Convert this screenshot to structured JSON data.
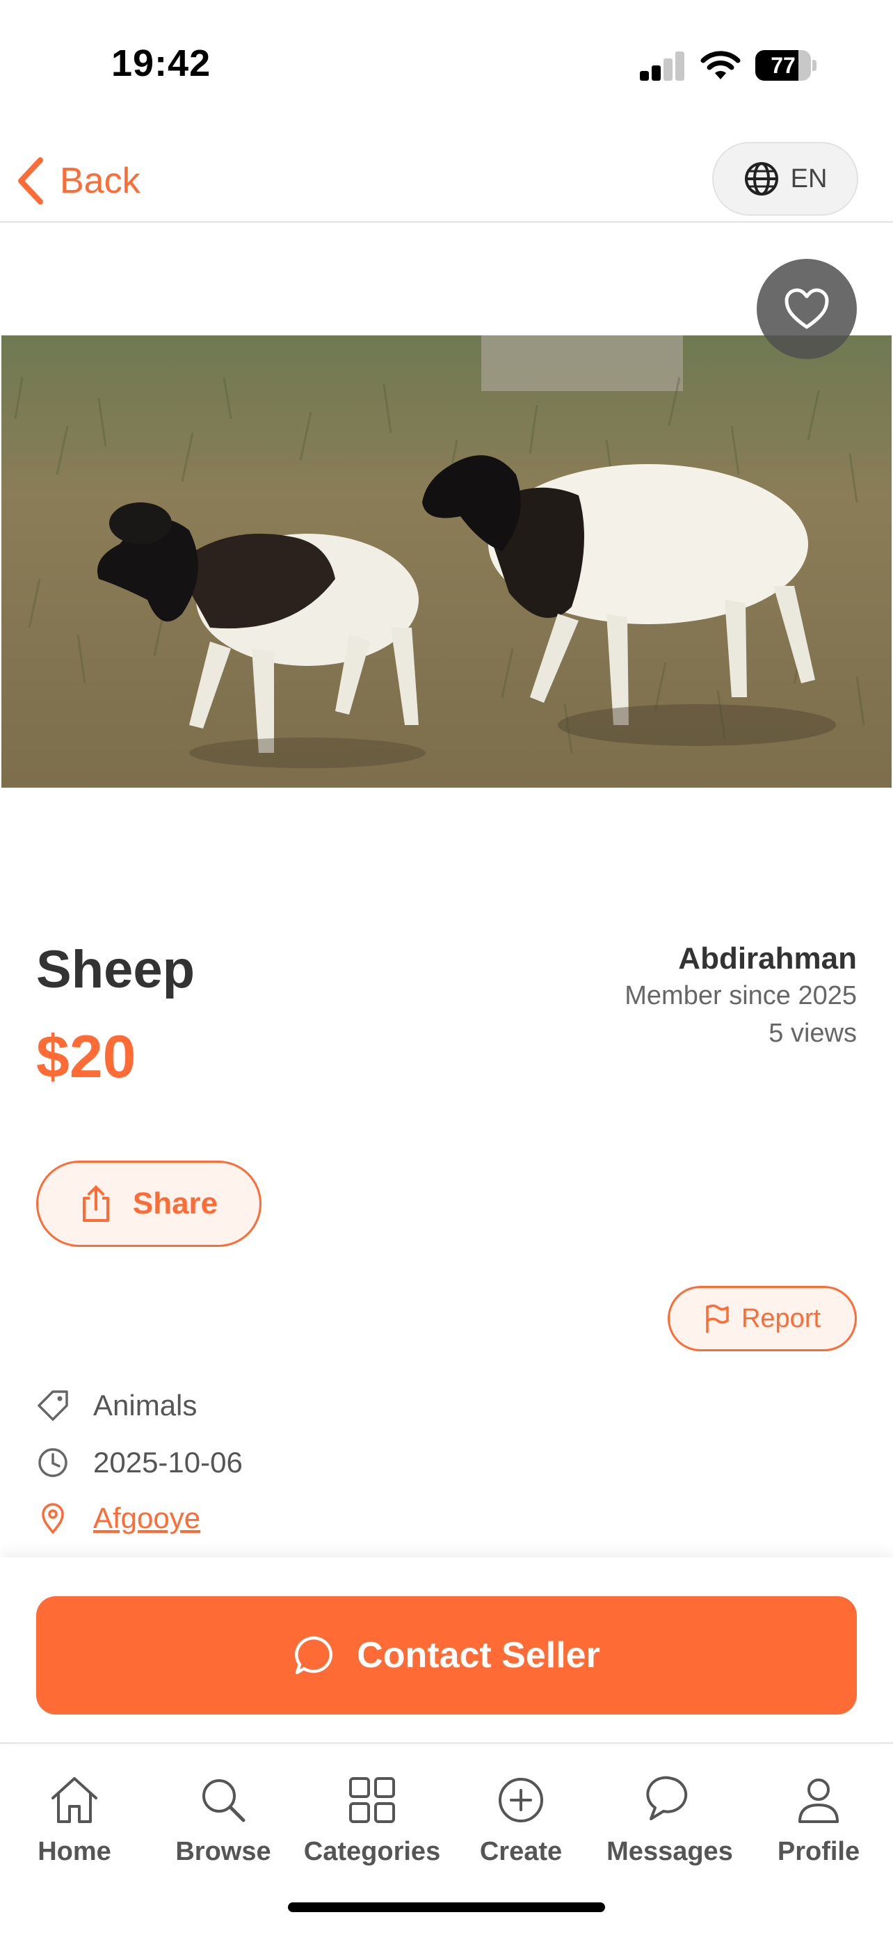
{
  "status_bar": {
    "time": "19:42",
    "battery": "77",
    "battery_level": 0.77
  },
  "header": {
    "back_label": "Back",
    "language": "EN"
  },
  "listing": {
    "title": "Sheep",
    "price": "$20",
    "category": "Animals",
    "date": "2025-10-06",
    "location": "Afgooye",
    "image_alt": "Two black-headed sheep walking in a grassy field"
  },
  "seller": {
    "name": "Abdirahman",
    "member_since": "Member since 2025",
    "views": "5 views"
  },
  "actions": {
    "share_label": "Share",
    "report_label": "Report",
    "contact_label": "Contact Seller"
  },
  "tabs": [
    {
      "label": "Home",
      "icon": "home-icon"
    },
    {
      "label": "Browse",
      "icon": "search-icon"
    },
    {
      "label": "Categories",
      "icon": "grid-icon"
    },
    {
      "label": "Create",
      "icon": "plus-circle-icon"
    },
    {
      "label": "Messages",
      "icon": "chat-icon"
    },
    {
      "label": "Profile",
      "icon": "person-icon"
    }
  ],
  "colors": {
    "accent": "#ff6b35",
    "text": "#333333",
    "muted": "#666666"
  }
}
